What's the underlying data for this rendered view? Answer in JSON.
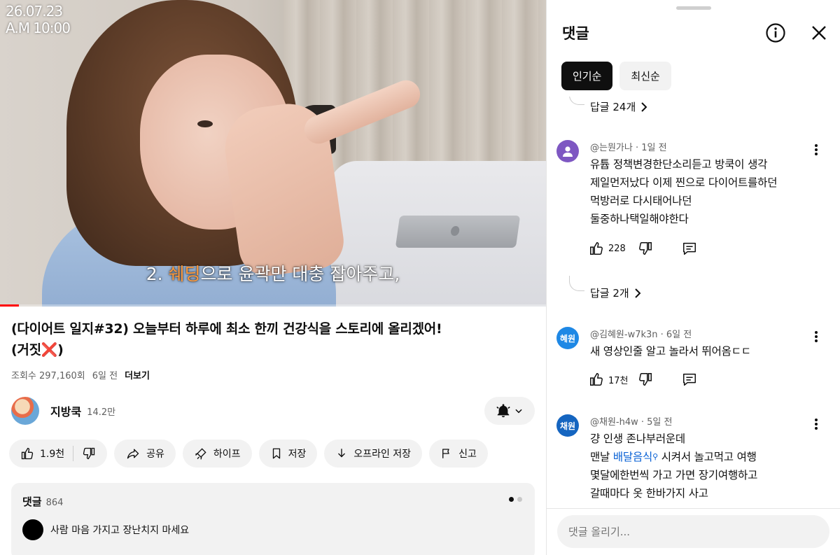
{
  "video": {
    "timestamp_date": "26.07.23",
    "timestamp_time": "A.M 10:00",
    "subtitle_prefix": "2. ",
    "subtitle_highlight": "쉐딩",
    "subtitle_rest": "으로 윤곽만 대충 잡아주고,",
    "progress_fraction": 0.035,
    "colors": {
      "progress": "#ff0000",
      "subtitle_highlight": "#ff9a3c"
    }
  },
  "info": {
    "title_line1": "(다이어트 일지#32) 오늘부터 하루에 최소 한끼 건강식을 스토리에 올리겠어!",
    "title_line2": "(거짓❌)",
    "views": "조회수 297,160회",
    "age": "6일 전",
    "more": "더보기"
  },
  "channel": {
    "name": "지방쿡",
    "subscribers": "14.2만",
    "bell_icon": "bell-icon"
  },
  "actions": {
    "like_count": "1.9천",
    "share": "공유",
    "hype": "하이프",
    "save": "저장",
    "download": "오프라인 저장",
    "report": "신고"
  },
  "comments_box": {
    "label": "댓글",
    "count": "864",
    "preview_text": "사람 마음 가지고 장난치지 마세요"
  },
  "panel": {
    "title": "댓글",
    "sort_tabs": [
      {
        "label": "인기순",
        "selected": true
      },
      {
        "label": "최신순",
        "selected": false
      }
    ],
    "top_replies": "답글 24개",
    "comments": [
      {
        "author": "@는뭔가나 · 1일 전",
        "avatar_text": "",
        "avatar_color": "#7e57c2",
        "lines": [
          "유튭 정책변경한단소리듣고 방쿡이 생각",
          "제일먼저났다 이제 찐으로 다이어트를하던",
          "먹방러로 다시태어나던",
          "둘중하나택일해야한다"
        ],
        "likes": "228",
        "replies": "답글 2개"
      },
      {
        "author": "@김혜원-w7k3n · 6일 전",
        "avatar_text": "혜원",
        "avatar_color": "#1e88e5",
        "lines": [
          "새 영상인줄 알고 놀라서 뛰어옴ㄷㄷ"
        ],
        "likes": "17천"
      },
      {
        "author": "@채원-h4w · 5일 전",
        "avatar_text": "채원",
        "avatar_color": "#1565c0",
        "line1": "걍 인생 존나부러운데",
        "line2_pre": "맨날 ",
        "line2_link": "배달음식",
        "line2_post": " 시켜서 놀고먹고 여행",
        "line3": "몇달에한번씩 가고 가면 장기여행하고",
        "line4": "갈때마다 옷 한바가지 사고"
      }
    ],
    "input_placeholder": "댓글 올리기..."
  }
}
